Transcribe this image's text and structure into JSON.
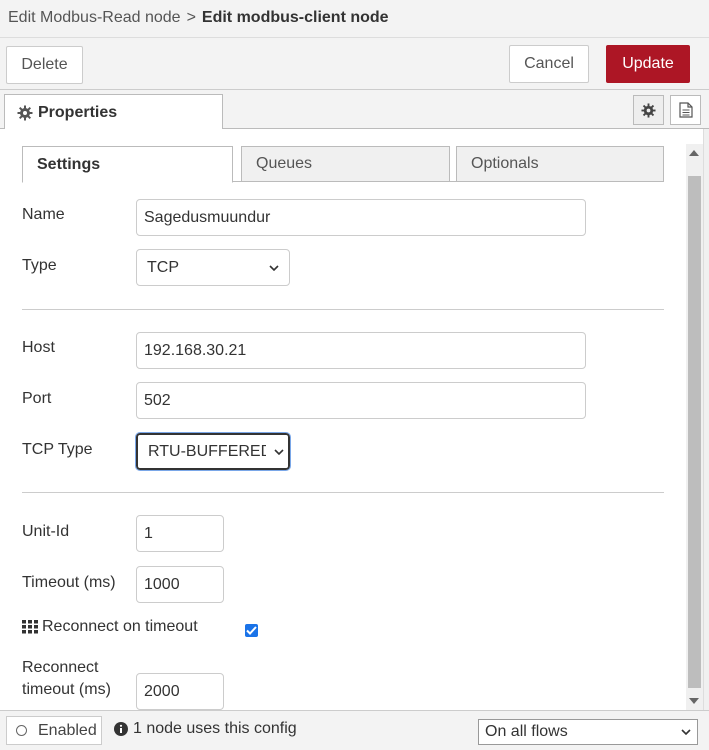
{
  "breadcrumb": {
    "parent": "Edit Modbus-Read node",
    "separator": ">",
    "current": "Edit modbus-client node"
  },
  "toolbar": {
    "delete_label": "Delete",
    "cancel_label": "Cancel",
    "update_label": "Update"
  },
  "tabs": {
    "properties_label": "Properties",
    "settings_icon": "gear-icon",
    "description_icon": "document-icon"
  },
  "subtabs": [
    {
      "label": "Settings",
      "active": true
    },
    {
      "label": "Queues",
      "active": false
    },
    {
      "label": "Optionals",
      "active": false
    }
  ],
  "form": {
    "name": {
      "label": "Name",
      "value": "Sagedusmuundur"
    },
    "type": {
      "label": "Type",
      "value": "TCP"
    },
    "host": {
      "label": "Host",
      "value": "192.168.30.21"
    },
    "port": {
      "label": "Port",
      "value": "502"
    },
    "tcp_type": {
      "label": "TCP Type",
      "value": "RTU-BUFFERED"
    },
    "unit_id": {
      "label": "Unit-Id",
      "value": "1"
    },
    "timeout": {
      "label": "Timeout (ms)",
      "value": "1000"
    },
    "reconnect_on_timeout": {
      "label": "Reconnect on timeout",
      "checked": true
    },
    "reconnect_timeout": {
      "label_line1": "Reconnect",
      "label_line2": "timeout (ms)",
      "value": "2000"
    }
  },
  "footer": {
    "enabled_label": "Enabled",
    "usage_text": "1 node uses this config",
    "scope_value": "On all flows"
  },
  "colors": {
    "update_button": "#ad1625",
    "checkbox": "#1a73e8",
    "panel_background": "#f3f3f3"
  }
}
